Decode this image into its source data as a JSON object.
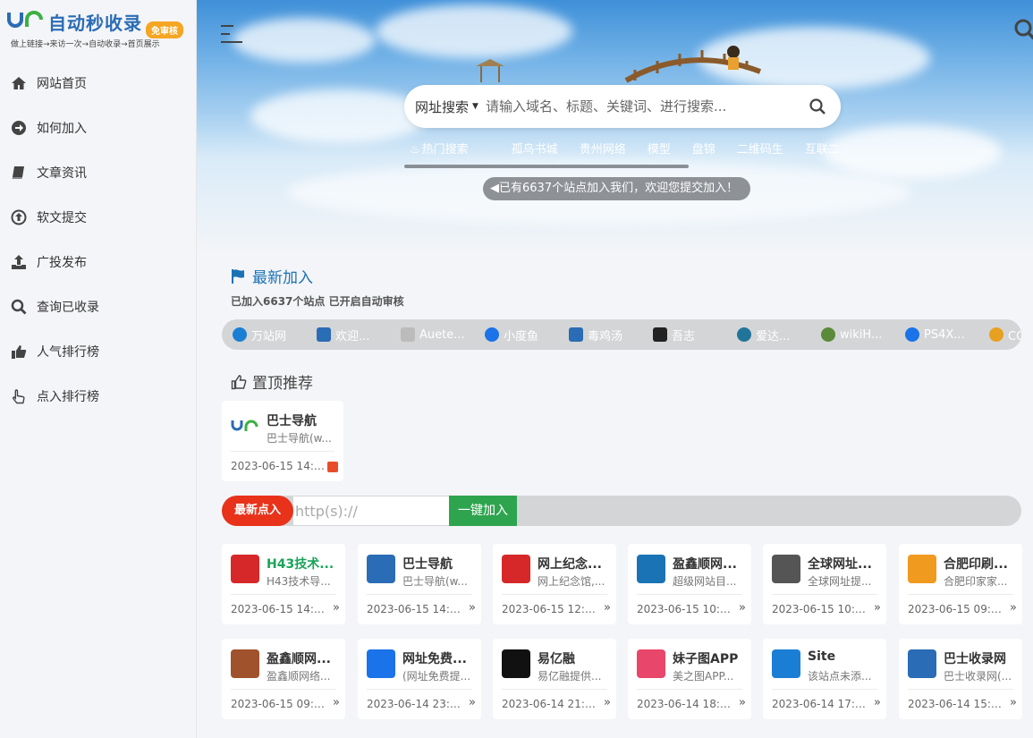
{
  "logo": {
    "title": "自动秒收录",
    "badge": "免审核",
    "subtitle": "做上链接→来访一次→自动收录→首页展示"
  },
  "sidebar": {
    "items": [
      {
        "label": "网站首页",
        "icon": "home-icon"
      },
      {
        "label": "如何加入",
        "icon": "arrow-circle-icon"
      },
      {
        "label": "文章资讯",
        "icon": "book-icon"
      },
      {
        "label": "软文提交",
        "icon": "upload-circle-icon"
      },
      {
        "label": "广投发布",
        "icon": "upload-icon"
      },
      {
        "label": "查询已收录",
        "icon": "search-icon"
      },
      {
        "label": "人气排行榜",
        "icon": "thumbs-up-icon"
      },
      {
        "label": "点入排行榜",
        "icon": "pointer-icon"
      }
    ]
  },
  "search": {
    "type": "网址搜索",
    "placeholder": "请输入域名、标题、关键词、进行搜索..."
  },
  "hot": {
    "label": "热门搜索",
    "items": [
      "孤鸟书城",
      "贵州网络",
      "模型",
      "盘锦",
      "二维码生",
      "互联二"
    ]
  },
  "notice": "已有6637个站点加入我们，欢迎您提交加入！",
  "newest": {
    "title": "最新加入",
    "subtitle": "已加入6637个站点 已开启自动审核",
    "items": [
      {
        "name": "万站网",
        "color": "#1a7fd4"
      },
      {
        "name": "欢迎...",
        "color": "#2a6cb5"
      },
      {
        "name": "Auete...",
        "color": "#bbbbbb"
      },
      {
        "name": "小度鱼",
        "color": "#1a73e8"
      },
      {
        "name": "毒鸡汤",
        "color": "#2a6cb5"
      },
      {
        "name": "吾志",
        "color": "#222222"
      },
      {
        "name": "爱达...",
        "color": "#21759b"
      },
      {
        "name": "wikiH...",
        "color": "#5a8a3a"
      },
      {
        "name": "PS4X...",
        "color": "#1a73e8"
      },
      {
        "name": "CC下载",
        "color": "#e8a020"
      }
    ]
  },
  "top": {
    "title": "置顶推荐",
    "card": {
      "name": "巴士导航",
      "desc": "巴士导航(w...",
      "date": "2023-06-15 14:1..."
    }
  },
  "submit": {
    "label": "最新点入",
    "placeholder": "http(s)://",
    "button": "一键加入"
  },
  "cards": [
    {
      "name": "H43技术...",
      "desc": "H43技术导...",
      "date": "2023-06-15 14:2...",
      "icon_color": "#d62828",
      "name_color": "#1aa35a"
    },
    {
      "name": "巴士导航",
      "desc": "巴士导航(w...",
      "date": "2023-06-15 14:1...",
      "icon_color": "#2a6cb5",
      "name_color": "#333333"
    },
    {
      "name": "网上纪念...",
      "desc": "网上纪念馆,...",
      "date": "2023-06-15 12:2...",
      "icon_color": "#d62828",
      "name_color": "#333333"
    },
    {
      "name": "盈鑫顺网...",
      "desc": "超级网站目...",
      "date": "2023-06-15 10:3...",
      "icon_color": "#1a73b5",
      "name_color": "#333333"
    },
    {
      "name": "全球网址...",
      "desc": "全球网址提...",
      "date": "2023-06-15 10:2...",
      "icon_color": "#555555",
      "name_color": "#333333"
    },
    {
      "name": "合肥印刷...",
      "desc": "合肥印家家...",
      "date": "2023-06-15 09:5...",
      "icon_color": "#f09a20",
      "name_color": "#333333"
    },
    {
      "name": "盈鑫顺网...",
      "desc": "盈鑫顺网络...",
      "date": "2023-06-15 09:3...",
      "icon_color": "#a0522d",
      "name_color": "#333333"
    },
    {
      "name": "网址免费...",
      "desc": "(网址免费提...",
      "date": "2023-06-14 23:0...",
      "icon_color": "#1a73e8",
      "name_color": "#333333"
    },
    {
      "name": "易亿融",
      "desc": "易亿融提供...",
      "date": "2023-06-14 21:1...",
      "icon_color": "#111111",
      "name_color": "#333333"
    },
    {
      "name": "妹子图APP",
      "desc": "美之图APP...",
      "date": "2023-06-14 18:0...",
      "icon_color": "#e8466a",
      "name_color": "#333333"
    },
    {
      "name": "Site",
      "desc": "该站点未添...",
      "date": "2023-06-14 17:4...",
      "icon_color": "#1a7fd4",
      "name_color": "#333333"
    },
    {
      "name": "巴士收录网",
      "desc": "巴士收录网(...",
      "date": "2023-06-14 15:3...",
      "icon_color": "#2a6cb5",
      "name_color": "#333333"
    }
  ]
}
